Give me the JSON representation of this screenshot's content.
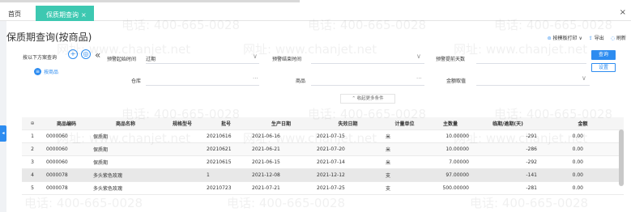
{
  "tabs": {
    "home": "首页",
    "active": "保质期查询",
    "close_glyph": "×"
  },
  "window_close": "×",
  "page_title": "保质期查询(按商品)",
  "actions": [
    {
      "icon": "printer-icon",
      "glyph": "⊜",
      "label": "按模板打印 ∨"
    },
    {
      "icon": "export-icon",
      "glyph": "⇪",
      "label": "导出"
    },
    {
      "icon": "refresh-icon",
      "glyph": "◌",
      "label": "刷新"
    }
  ],
  "query": {
    "label": "按以下方案查询",
    "add_glyph": "+",
    "preset_glyph": "◎",
    "collapse_glyph": "«",
    "by_product": "按商品",
    "by_product_glyph": "≡"
  },
  "filters": {
    "warn_start_label": "预警起始时间",
    "warn_start_value": "过期",
    "warn_end_label": "预警结束时间",
    "warn_end_value": "",
    "warn_days_label": "预警提前天数",
    "warn_days_value": "",
    "warehouse_label": "仓库",
    "product_label": "商品",
    "amount_label": "金额取值",
    "chevron_glyph": "∨",
    "dots_glyph": "···"
  },
  "buttons": {
    "search": "查询",
    "settings": "设置"
  },
  "more_conditions": "⌃ 收起更多条件",
  "side_tab": "◂",
  "table": {
    "header_icon": "⊕",
    "headers": [
      "商品编码",
      "商品名称",
      "规格型号",
      "批号",
      "生产日期",
      "失效日期",
      "计量单位",
      "主数量",
      "临期/逾期(天)",
      "金额"
    ],
    "rows": [
      {
        "idx": "1",
        "code": "0000060",
        "name": "保质期",
        "spec": "",
        "batch": "20210616",
        "prod": "2021-06-16",
        "expire": "2021-07-15",
        "unit": "米",
        "qty": "10.00000",
        "days": "-291",
        "amount": "0.00"
      },
      {
        "idx": "2",
        "code": "0000060",
        "name": "保质期",
        "spec": "",
        "batch": "20210621",
        "prod": "2021-06-21",
        "expire": "2021-07-20",
        "unit": "米",
        "qty": "10.00000",
        "days": "-286",
        "amount": "0.00"
      },
      {
        "idx": "3",
        "code": "0000060",
        "name": "保质期",
        "spec": "",
        "batch": "20210615",
        "prod": "2021-06-15",
        "expire": "2021-07-14",
        "unit": "米",
        "qty": "7.00000",
        "days": "-292",
        "amount": "0.00"
      },
      {
        "idx": "4",
        "code": "0000078",
        "name": "多头紫色玫瑰",
        "spec": "",
        "batch": "1",
        "prod": "2021-12-08",
        "expire": "2021-12-12",
        "unit": "支",
        "qty": "97.00000",
        "days": "-141",
        "amount": "0.00"
      },
      {
        "idx": "5",
        "code": "0000078",
        "name": "多头紫色玫瑰",
        "spec": "",
        "batch": "20210723",
        "prod": "2021-07-21",
        "expire": "2021-07-25",
        "unit": "支",
        "qty": "500.00000",
        "days": "-281",
        "amount": "0.00"
      }
    ]
  },
  "watermarks": {
    "phone": "电话: 400-665-0028",
    "site": "网址: www.chanjet.net"
  },
  "colors": {
    "tab_active": "#3dc8b1",
    "accent": "#2d8cf0",
    "negative": "#ed4014"
  }
}
